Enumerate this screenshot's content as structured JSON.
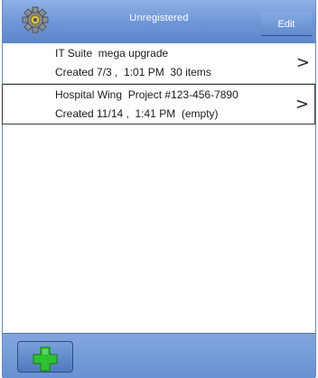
{
  "header": {
    "title": "Unregistered",
    "edit_label": "Edit",
    "settings_icon": "gear-icon"
  },
  "projects": [
    {
      "name": "IT Suite  mega upgrade",
      "details": "Created 7/3 ,  1:01 PM  30 items",
      "chevron": ">"
    },
    {
      "name": "Hospital Wing  Project #123-456-7890",
      "details": "Created 11/14 ,  1:41 PM  (empty)",
      "chevron": ">",
      "selected": true
    }
  ],
  "footer": {
    "add_icon": "plus-icon",
    "add_icon_color": "#2fc12f"
  },
  "colors": {
    "bar_blue": "#6f97d8",
    "border": "#4a6fa8"
  }
}
